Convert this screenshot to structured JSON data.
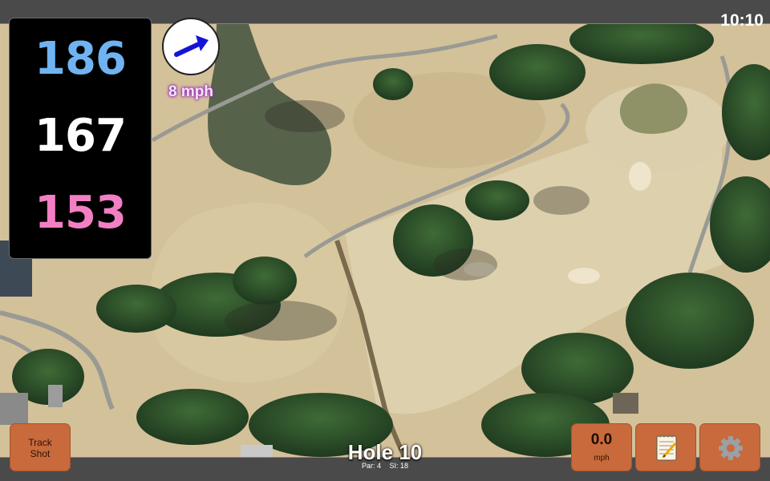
{
  "status": {
    "time": "10:10"
  },
  "yardage": {
    "back": "186",
    "middle": "167",
    "front": "153",
    "colors": {
      "back": "#6fb3f2",
      "middle": "#ffffff",
      "front": "#f27fc4"
    }
  },
  "wind": {
    "speed": "8 mph",
    "icon": "wind-direction-arrow-icon",
    "arrow_color": "#1414d8"
  },
  "hole": {
    "title": "Hole 10",
    "par": "Par: 4",
    "si": "SI: 18"
  },
  "buttons": {
    "track_shot": {
      "line1": "Track",
      "line2": "Shot"
    },
    "speed": {
      "value": "0.0",
      "unit": "mph"
    },
    "notes": {
      "icon": "notepad-icon"
    },
    "settings": {
      "icon": "gear-icon"
    }
  },
  "colors": {
    "button": "#c86a3c",
    "bar": "#4a4a4a",
    "accent_border": "#c05aa5"
  }
}
